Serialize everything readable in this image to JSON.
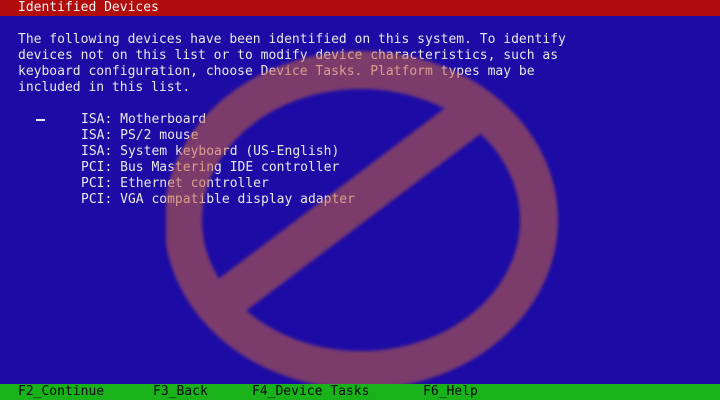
{
  "header": {
    "title": "Identified Devices"
  },
  "intro": {
    "lines": [
      "The following devices have been identified on this system. To identify",
      "devices not on this list or to modify device characteristics, such as",
      "keyboard configuration, choose Device Tasks. Platform types may be",
      "included in this list."
    ]
  },
  "devices": [
    "ISA: Motherboard",
    "ISA: PS/2 mouse",
    "ISA: System keyboard (US-English)",
    "PCI: Bus Mastering IDE controller",
    "PCI: Ethernet controller",
    "PCI: VGA compatible display adapter"
  ],
  "footer": {
    "continue_label": "F2_Continue",
    "back_label": "F3_Back",
    "device_tasks_label": "F4_Device Tasks",
    "help_label": "F6_Help"
  },
  "icons": {
    "watermark": "prohibited-icon"
  },
  "colors": {
    "background": "#1d0ba5",
    "title_bar": "#b10d0d",
    "function_bar": "#19b21a",
    "text": "#e8e8e8",
    "watermark": "#c8643e"
  }
}
